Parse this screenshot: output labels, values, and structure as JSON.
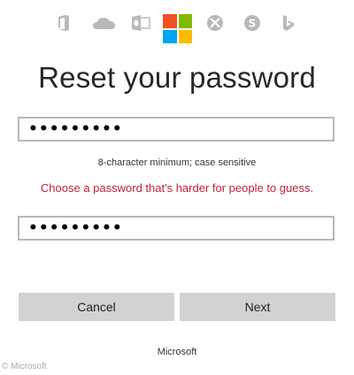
{
  "header": {
    "app_icons": [
      "office-icon",
      "onedrive-icon",
      "outlook-icon",
      "xbox-icon",
      "skype-icon",
      "bing-icon"
    ],
    "logo_colors": {
      "red": "#f25022",
      "green": "#7fba00",
      "blue": "#00a4ef",
      "yellow": "#ffb900"
    },
    "icon_color": "#b9b9b9"
  },
  "form": {
    "title": "Reset your password",
    "password_value": "•••••••••",
    "hint": "8-character minimum; case sensitive",
    "error": "Choose a password that's harder for people to guess.",
    "confirm_value": "•••••••••",
    "error_color": "#c4213a"
  },
  "buttons": {
    "cancel": "Cancel",
    "next": "Next"
  },
  "footer": {
    "brand": "Microsoft"
  },
  "watermark": "© Microsoft"
}
